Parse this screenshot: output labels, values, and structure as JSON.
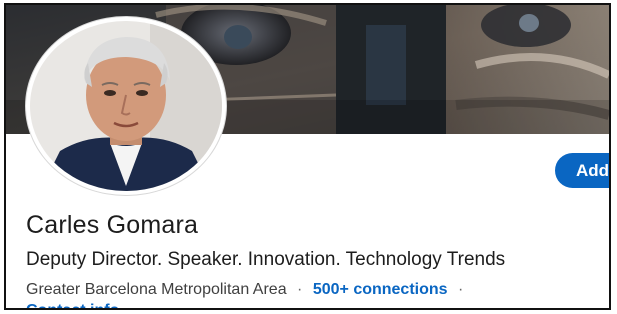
{
  "profile": {
    "name": "Carles Gomara",
    "headline": "Deputy Director. Speaker. Innovation. Technology Trends",
    "location": "Greater Barcelona Metropolitan Area",
    "separator": "·",
    "connections": "500+ connections",
    "contact_info": "Contact info"
  },
  "actions": {
    "add_label": "Add"
  },
  "colors": {
    "accent": "#0a66c2",
    "text": "#1d1d1d",
    "secondary_text": "#404040"
  }
}
